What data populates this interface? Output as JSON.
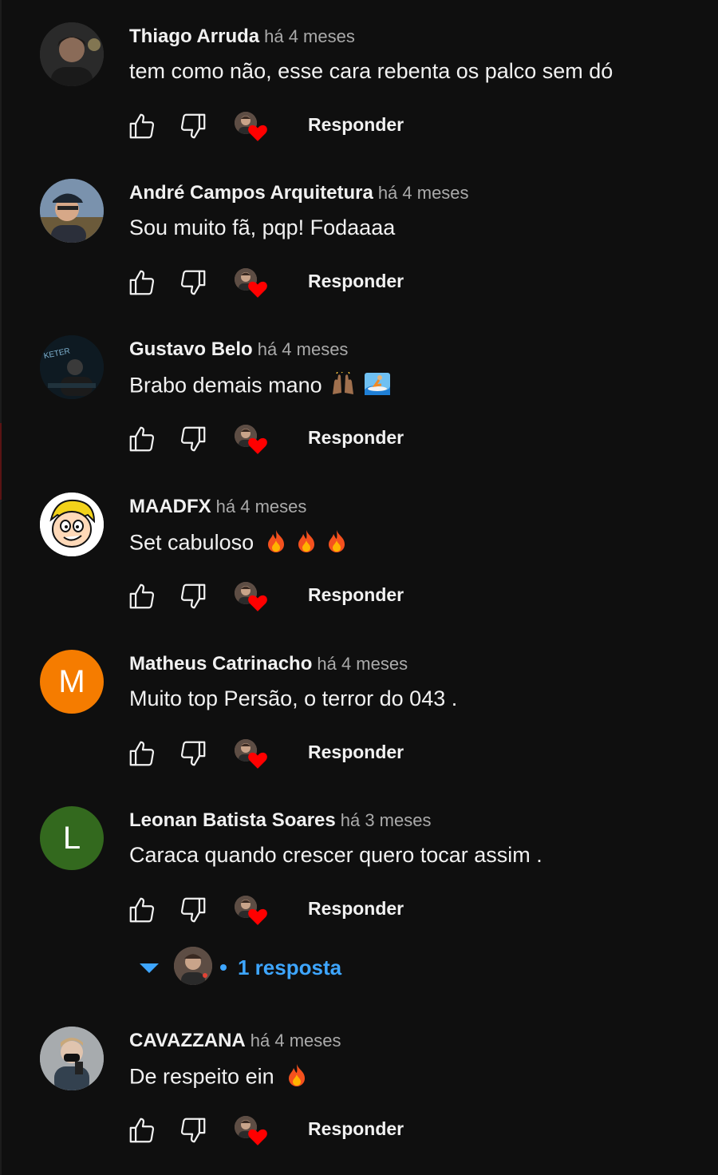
{
  "comments": [
    {
      "author": "Thiago Arruda",
      "time": "há 4 meses",
      "text": "tem como não, esse cara rebenta os palco sem dó",
      "reply_label": "Responder"
    },
    {
      "author": "André Campos Arquitetura",
      "time": "há 4 meses",
      "text": "Sou muito fã, pqp! Fodaaaa",
      "reply_label": "Responder"
    },
    {
      "author": "Gustavo Belo",
      "time": "há 4 meses",
      "text": "Brabo demais mano",
      "reply_label": "Responder"
    },
    {
      "author": "MAADFX",
      "time": "há 4 meses",
      "text": "Set cabuloso",
      "reply_label": "Responder"
    },
    {
      "author": "Matheus Catrinacho",
      "time": "há 4 meses",
      "text": "Muito top Persão, o terror do 043 .",
      "reply_label": "Responder",
      "avatar_letter": "M"
    },
    {
      "author": "Leonan Batista Soares",
      "time": "há 3 meses",
      "text": "Caraca quando crescer quero tocar assim .",
      "reply_label": "Responder",
      "avatar_letter": "L"
    },
    {
      "author": "CAVAZZANA",
      "time": "há 4 meses",
      "text": "De respeito ein",
      "reply_label": "Responder"
    }
  ],
  "replies_toggle": {
    "label": "1 resposta"
  },
  "icons": {
    "like": "thumbs-up-icon",
    "dislike": "thumbs-down-icon",
    "creator_heart": "creator-heart-icon",
    "expand": "caret-down-icon",
    "emoji_raised_hands": "raised-hands-emoji",
    "emoji_surfer": "surfer-emoji",
    "emoji_fire": "fire-emoji"
  },
  "colors": {
    "background": "#0f0f0f",
    "text": "#f1f1f1",
    "secondary": "#aaaaaa",
    "link": "#3ea6ff",
    "heart": "#ff0000",
    "avatar_m": "#f57c00",
    "avatar_l": "#33691e"
  }
}
